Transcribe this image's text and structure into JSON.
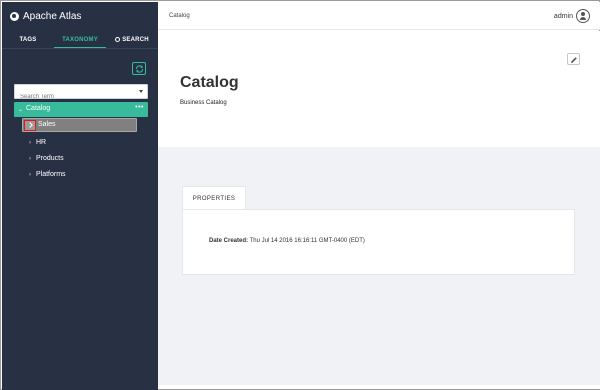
{
  "app": {
    "title": "Apache Atlas"
  },
  "sidebar": {
    "tabs": [
      {
        "label": "TAGS"
      },
      {
        "label": "TAXONOMY"
      },
      {
        "label": "SEARCH"
      }
    ],
    "search": {
      "placeholder": "Search Term"
    },
    "tree": {
      "root": {
        "label": "Catalog",
        "more": "•••"
      },
      "selected": {
        "label": "Sales"
      },
      "children": [
        {
          "label": "HR"
        },
        {
          "label": "Products"
        },
        {
          "label": "Platforms"
        }
      ]
    }
  },
  "header": {
    "breadcrumb": "Catalog",
    "user": "admin"
  },
  "main": {
    "title": "Catalog",
    "subtitle": "Business Catalog",
    "properties_tab": "PROPERTIES",
    "properties": {
      "label": "Date Created:",
      "value": "Thu Jul 14 2016 16:16:11 GMT-0400 (EDT)"
    }
  },
  "colors": {
    "sidebar_bg": "#283144",
    "accent": "#37bb9b",
    "selection_outline": "#e01a1a"
  }
}
